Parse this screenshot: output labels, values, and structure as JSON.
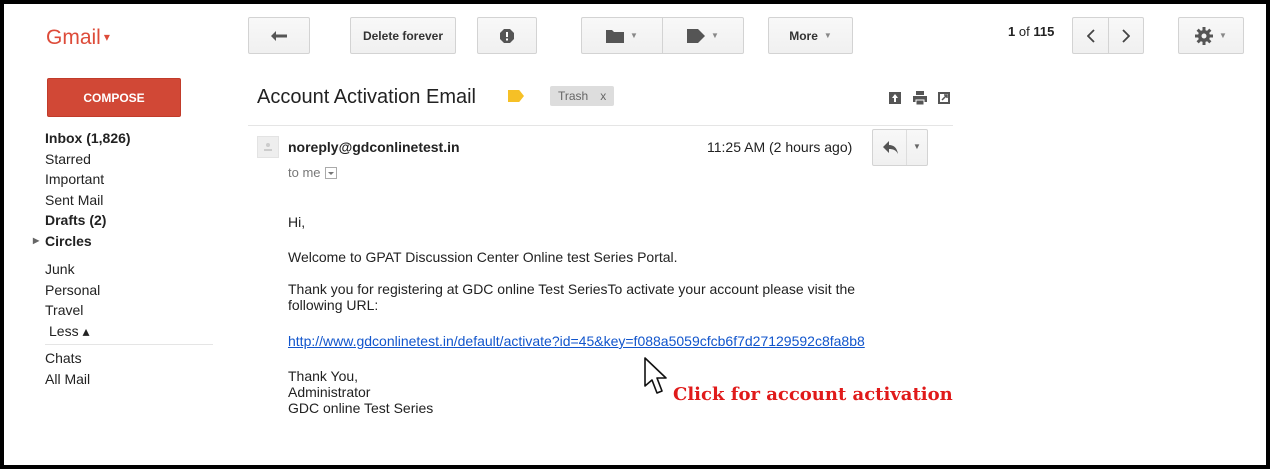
{
  "app": {
    "logo": "Gmail",
    "colors": {
      "accent": "#dd4b39",
      "compose": "#d14836",
      "link": "#1155cc",
      "annotation": "#e01a1a"
    }
  },
  "toolbar": {
    "back_icon": "arrow-left-icon",
    "delete_label": "Delete forever",
    "spam_icon": "report-spam-icon",
    "move_icon": "folder-icon",
    "labels_icon": "label-tag-icon",
    "more_label": "More",
    "pager": {
      "current": "1",
      "of_text": "of",
      "total": "115"
    },
    "settings_icon": "gear-icon"
  },
  "nav": {
    "compose_label": "COMPOSE",
    "items": [
      {
        "label": "Inbox (1,826)",
        "bold": true
      },
      {
        "label": "Starred"
      },
      {
        "label": "Important"
      },
      {
        "label": "Sent Mail"
      },
      {
        "label": "Drafts (2)",
        "bold": true
      },
      {
        "label": "Circles",
        "bold": true
      }
    ],
    "items2": [
      {
        "label": "Junk"
      },
      {
        "label": "Personal"
      },
      {
        "label": "Travel"
      },
      {
        "label": "Less ▴"
      }
    ],
    "items3": [
      {
        "label": "Chats"
      },
      {
        "label": "All Mail"
      }
    ]
  },
  "message": {
    "subject": "Account Activation Email",
    "label_chip": "Trash",
    "label_chip_close": "x",
    "sender": "noreply@gdconlinetest.in",
    "to": "to me",
    "time": "11:25 AM (2 hours ago)",
    "body": {
      "greeting": "Hi,",
      "welcome": "Welcome to GPAT Discussion Center Online test Series Portal.",
      "thanks_line1": "Thank you for registering at GDC online Test SeriesTo activate your account please visit the",
      "thanks_line2": "following URL:",
      "link": "http://www.gdconlinetest.in/default/activate?id=45&key=f088a5059cfcb6f7d27129592c8fa8b8",
      "sign1": "Thank You,",
      "sign2": "Administrator",
      "sign3": "GDC online Test Series"
    }
  },
  "annotation": {
    "text": "Click for account activation"
  }
}
